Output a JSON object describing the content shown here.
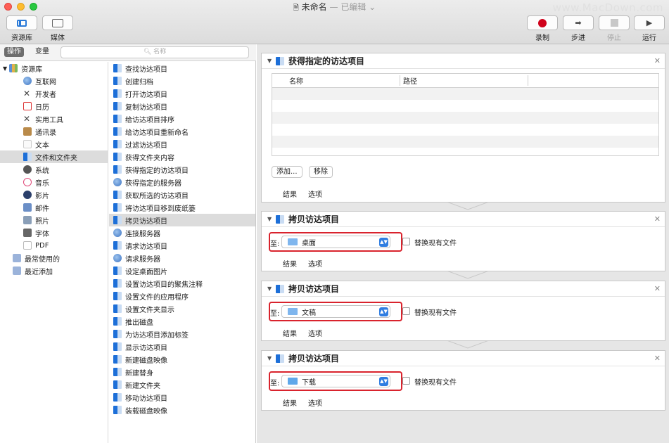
{
  "window": {
    "title": "未命名",
    "edited": "— 已编辑 ⌄",
    "watermark": "www.MacDown.com"
  },
  "toolbar": {
    "library_label": "资源库",
    "media_label": "媒体",
    "record_label": "录制",
    "step_label": "步进",
    "stop_label": "停止",
    "run_label": "运行"
  },
  "left_header": {
    "actions_tab": "操作",
    "variables_tab": "变量",
    "search_placeholder": "名称"
  },
  "library": {
    "root": "资源库",
    "items": [
      "互联网",
      "开发者",
      "日历",
      "实用工具",
      "通讯录",
      "文本",
      "文件和文件夹",
      "系统",
      "音乐",
      "影片",
      "邮件",
      "照片",
      "字体",
      "PDF"
    ],
    "selected": "文件和文件夹",
    "extra": [
      "最常使用的",
      "最近添加"
    ]
  },
  "actions": {
    "items": [
      "查找访达项目",
      "创建归档",
      "打开访达项目",
      "复制访达项目",
      "给访达项目排序",
      "给访达项目重新命名",
      "过滤访达项目",
      "获得文件夹内容",
      "获得指定的访达项目",
      "获得指定的服务器",
      "获取所选的访达项目",
      "将访达项目移到废纸篓",
      "拷贝访达项目",
      "连接服务器",
      "请求访达项目",
      "请求服务器",
      "设定桌面图片",
      "设置访达项目的聚焦注释",
      "设置文件的应用程序",
      "设置文件夹显示",
      "推出磁盘",
      "为访达项目添加标签",
      "显示访达项目",
      "新建磁盘映像",
      "新建替身",
      "新建文件夹",
      "移动访达项目",
      "装载磁盘映像"
    ],
    "selected": "拷贝访达项目"
  },
  "workflow": {
    "get_items": {
      "title": "获得指定的访达项目",
      "col_name": "名称",
      "col_path": "路径",
      "add_button": "添加...",
      "remove_button": "移除",
      "results": "结果",
      "options": "选项"
    },
    "copy_steps": [
      {
        "title": "拷贝访达项目",
        "to_label": "至:",
        "destination": "桌面",
        "replace_label": "替换现有文件",
        "results": "结果",
        "options": "选项"
      },
      {
        "title": "拷贝访达项目",
        "to_label": "至:",
        "destination": "文稿",
        "replace_label": "替换现有文件",
        "results": "结果",
        "options": "选项"
      },
      {
        "title": "拷贝访达项目",
        "to_label": "至:",
        "destination": "下载",
        "replace_label": "替换现有文件",
        "results": "结果",
        "options": "选项"
      }
    ]
  },
  "colors": {
    "accent": "#2f7de1",
    "highlight": "#d9232d",
    "record": "#d0021b"
  }
}
